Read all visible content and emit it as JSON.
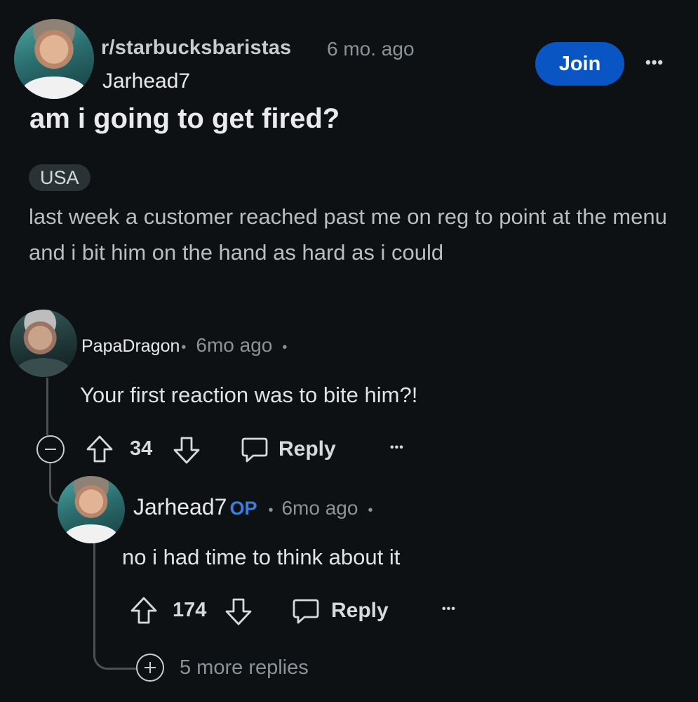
{
  "post": {
    "subreddit": "r/starbucksbaristas",
    "time": "6 mo. ago",
    "author": "Jarhead7",
    "join_label": "Join",
    "more": "•••",
    "title": "am i going to get fired?",
    "flair": "USA",
    "body": "last week a customer reached past me on reg to point at the menu and i bit him on the hand as hard as i could"
  },
  "comments": [
    {
      "username": "PapaDragon",
      "sep1": "•",
      "time": "6mo ago",
      "sep2": "•",
      "text": "Your first reaction was to bite him?!",
      "votes": "34",
      "reply_label": "Reply",
      "more": "•••"
    },
    {
      "username": "Jarhead7",
      "op_tag": "OP",
      "sep1": "•",
      "time": "6mo ago",
      "sep2": "•",
      "text": "no i had time to think about it",
      "votes": "174",
      "reply_label": "Reply",
      "more": "•••"
    }
  ],
  "more_replies": "5 more replies",
  "colors": {
    "background": "#0e1113",
    "join_button": "#0a55c4",
    "op_tag": "#3b7fe0"
  },
  "icons": [
    "collapse-icon",
    "upvote-icon",
    "downvote-icon",
    "reply-icon",
    "more-icon",
    "expand-icon"
  ]
}
